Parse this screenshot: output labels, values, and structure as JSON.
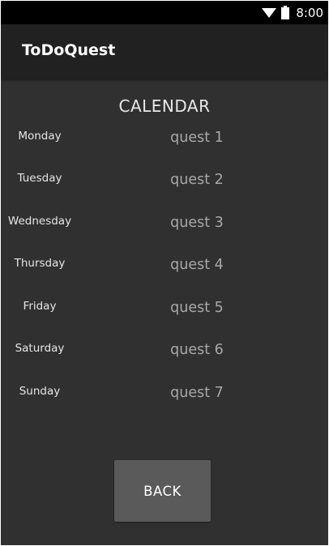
{
  "status_bar": {
    "time": "8:00",
    "icons": [
      "wifi-icon",
      "battery-icon"
    ]
  },
  "app_bar": {
    "title": "ToDoQuest"
  },
  "calendar": {
    "title": "CALENDAR",
    "rows": [
      {
        "day": "Monday",
        "quest": "quest 1"
      },
      {
        "day": "Tuesday",
        "quest": "quest 2"
      },
      {
        "day": "Wednesday",
        "quest": "quest 3"
      },
      {
        "day": "Thursday",
        "quest": "quest 4"
      },
      {
        "day": "Friday",
        "quest": "quest 5"
      },
      {
        "day": "Saturday",
        "quest": "quest 6"
      },
      {
        "day": "Sunday",
        "quest": "quest 7"
      }
    ]
  },
  "actions": {
    "back_label": "BACK"
  },
  "colors": {
    "background": "#303030",
    "app_bar": "#212121",
    "status_bar": "#000000",
    "button": "#5a5a5a",
    "quest_text": "#a8a8a8"
  }
}
